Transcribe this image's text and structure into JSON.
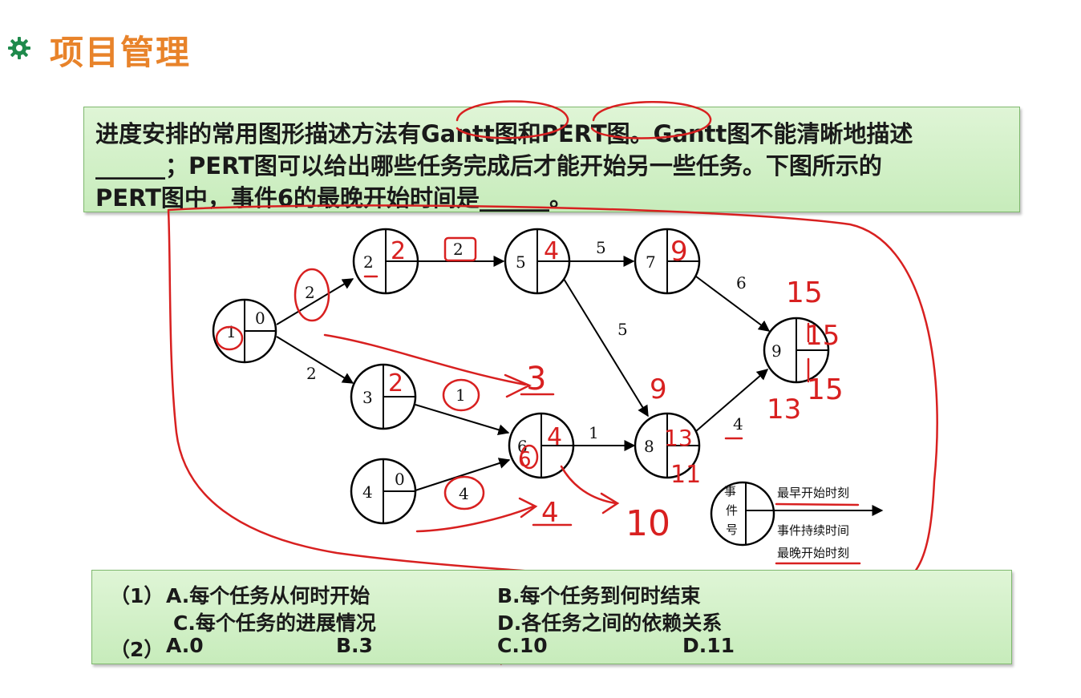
{
  "title": "项目管理",
  "question": {
    "line1": "进度安排的常用图形描述方法有Gantt图和PERT图。Gantt图不能清晰地描述",
    "line2": "______；PERT图可以给出哪些任务完成后才能开始另一些任务。下图所示的",
    "line3": "PERT图中，事件6的最晚开始时间是______。"
  },
  "options": {
    "q1_label": "（1）",
    "q1_a": "A.每个任务从何时开始",
    "q1_b": "B.每个任务到何时结束",
    "q1_c": "C.每个任务的进展情况",
    "q1_d": "D.各任务之间的依赖关系",
    "q2_label": "（2）",
    "q2_a": "A.0",
    "q2_b": "B.3",
    "q2_c": "C.10",
    "q2_d": "D.11"
  },
  "pert": {
    "nodes": [
      {
        "id": "1",
        "earliest": "0"
      },
      {
        "id": "2",
        "earliest": ""
      },
      {
        "id": "3",
        "earliest": ""
      },
      {
        "id": "4",
        "earliest": "0"
      },
      {
        "id": "5",
        "earliest": ""
      },
      {
        "id": "6",
        "earliest": ""
      },
      {
        "id": "7",
        "earliest": ""
      },
      {
        "id": "8",
        "earliest": ""
      },
      {
        "id": "9",
        "earliest": ""
      }
    ],
    "edges": [
      {
        "from": "1",
        "to": "2",
        "duration": "2"
      },
      {
        "from": "1",
        "to": "3",
        "duration": "2"
      },
      {
        "from": "2",
        "to": "5",
        "duration": "2"
      },
      {
        "from": "3",
        "to": "6",
        "duration": "1"
      },
      {
        "from": "4",
        "to": "6",
        "duration": "4"
      },
      {
        "from": "5",
        "to": "7",
        "duration": "5"
      },
      {
        "from": "5",
        "to": "8",
        "duration": "5"
      },
      {
        "from": "6",
        "to": "8",
        "duration": "1"
      },
      {
        "from": "7",
        "to": "9",
        "duration": "6"
      },
      {
        "from": "8",
        "to": "9",
        "duration": "4"
      }
    ],
    "legend": {
      "event_chars": [
        "事",
        "件",
        "号"
      ],
      "earliest": "最早开始时刻",
      "duration": "事件持续时间",
      "latest": "最晚开始时刻"
    }
  },
  "annotations": {
    "n2": "2",
    "n3": "2",
    "n5": "4",
    "n6": "6",
    "n6b": "4",
    "n7": "9",
    "n8": "9",
    "n8a": "13",
    "n8b": "11",
    "n9a": "15",
    "n9b": "15",
    "n9c": "15",
    "n9d": "13",
    "arrow_3": "3",
    "val_4": "4",
    "val_10": "10"
  },
  "colors": {
    "title": "#e8832a",
    "box_fill": "#d2f0c6",
    "ink": "#d82020"
  }
}
